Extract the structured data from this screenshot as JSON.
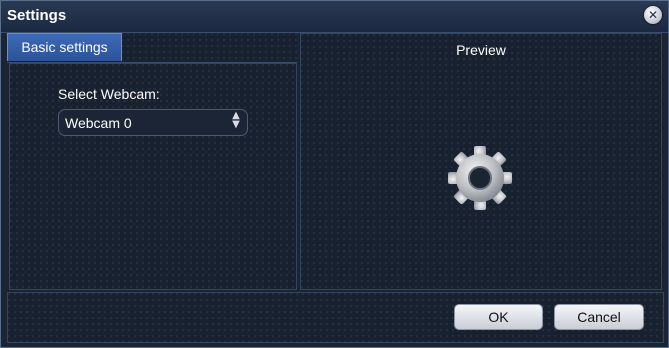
{
  "window": {
    "title": "Settings",
    "close_icon": "close-icon"
  },
  "tabs": [
    {
      "label": "Basic settings",
      "active": true
    }
  ],
  "basic_settings": {
    "webcam_label": "Select Webcam:",
    "webcam_selected": "Webcam 0"
  },
  "preview": {
    "title": "Preview",
    "loading_icon": "gear-icon"
  },
  "footer": {
    "ok_label": "OK",
    "cancel_label": "Cancel"
  },
  "colors": {
    "background": "#1b2432",
    "accent_tab": "#3d6ab8",
    "text": "#ffffff"
  }
}
